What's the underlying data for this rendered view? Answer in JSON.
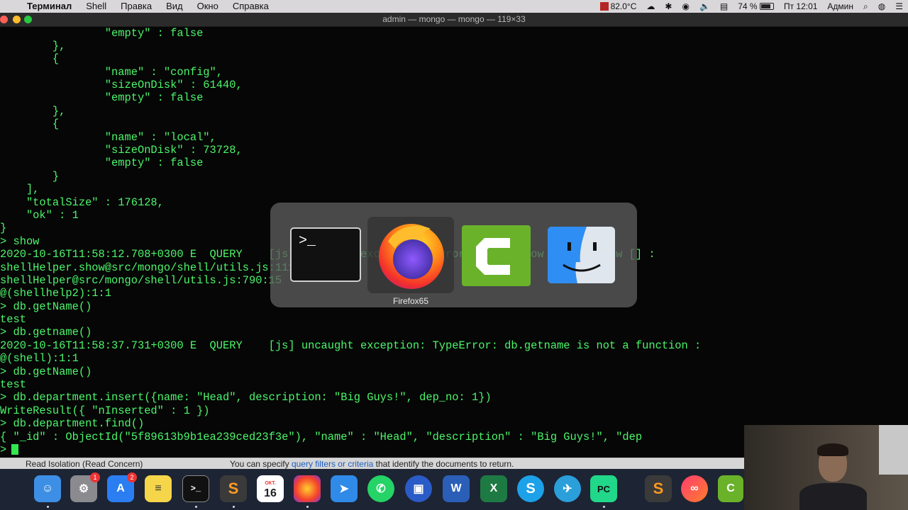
{
  "menubar": {
    "app_name": "Терминал",
    "items": [
      "Shell",
      "Правка",
      "Вид",
      "Окно",
      "Справка"
    ],
    "temperature": "82.0°C",
    "battery": "74 %",
    "clock": "Пт 12:01",
    "user": "Админ"
  },
  "window": {
    "title": "admin — mongo — mongo — 119×33"
  },
  "terminal": {
    "lines": [
      "                \"empty\" : false",
      "        },",
      "        {",
      "                \"name\" : \"config\",",
      "                \"sizeOnDisk\" : 61440,",
      "                \"empty\" : false",
      "        },",
      "        {",
      "                \"name\" : \"local\",",
      "                \"sizeOnDisk\" : 73728,",
      "                \"empty\" : false",
      "        }",
      "    ],",
      "    \"totalSize\" : 176128,",
      "    \"ok\" : 1",
      "}",
      "> show",
      "2020-10-16T11:58:12.708+0300 E  QUERY    [js] uncaught exception: Error: don't know how to show [] :",
      "shellHelper.show@src/mongo/shell/utils.js:1113:11",
      "shellHelper@src/mongo/shell/utils.js:790:15",
      "@(shellhelp2):1:1",
      "> db.getName()",
      "test",
      "> db.getname()",
      "2020-10-16T11:58:37.731+0300 E  QUERY    [js] uncaught exception: TypeError: db.getname is not a function :",
      "@(shell):1:1",
      "> db.getName()",
      "test",
      "> db.department.insert({name: \"Head\", description: \"Big Guys!\", dep_no: 1})",
      "WriteResult({ \"nInserted\" : 1 })",
      "> db.department.find()",
      "{ \"_id\" : ObjectId(\"5f89613b9b1ea239ced23f3e\"), \"name\" : \"Head\", \"description\" : \"Big Guys!\", \"dep",
      ">"
    ]
  },
  "app_switcher": {
    "apps": [
      {
        "name": "Terminal",
        "icon": "terminal-icon"
      },
      {
        "name": "Firefox65",
        "icon": "firefox-icon"
      },
      {
        "name": "Camtasia",
        "icon": "camtasia-icon"
      },
      {
        "name": "Finder",
        "icon": "finder-icon"
      }
    ],
    "selected_label": "Firefox65"
  },
  "bottom_strip": {
    "left_text": "Read Isolation (Read Concern)",
    "right_prefix": "You can specify ",
    "right_link": "query filters or criteria",
    "right_suffix": " that identify the documents to return."
  },
  "dock": {
    "calendar_month": "ОКТ.",
    "calendar_day": "16",
    "badge_prefs": "1",
    "badge_appstore": "2"
  }
}
